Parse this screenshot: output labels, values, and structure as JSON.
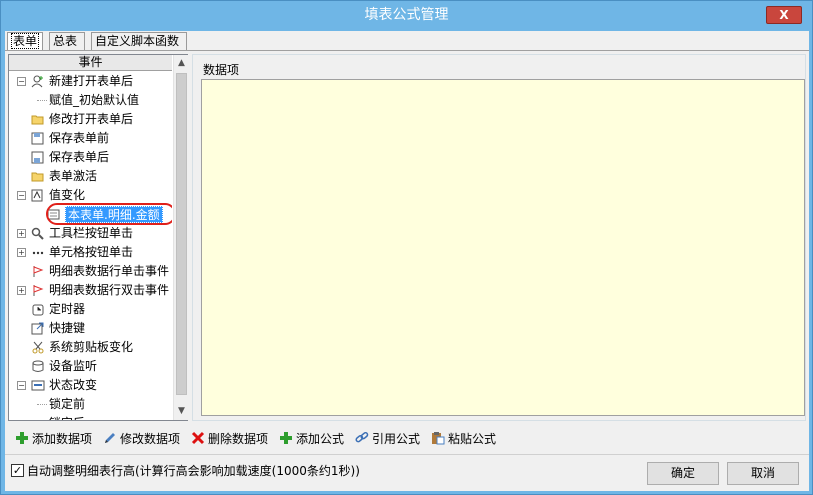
{
  "window": {
    "title": "填表公式管理",
    "close_label": "X"
  },
  "tabs": [
    {
      "label": "表单"
    },
    {
      "label": "总表"
    },
    {
      "label": "自定义脚本函数"
    }
  ],
  "tree": {
    "header": "事件",
    "items": [
      {
        "label": "新建打开表单后",
        "icon": "user-new-icon",
        "expander": "minus"
      },
      {
        "label": "赋值_初始默认值",
        "icon": "",
        "expander": ""
      },
      {
        "label": "修改打开表单后",
        "icon": "folder-open-icon",
        "expander": ""
      },
      {
        "label": "保存表单前",
        "icon": "save-icon",
        "expander": ""
      },
      {
        "label": "保存表单后",
        "icon": "save-after-icon",
        "expander": ""
      },
      {
        "label": "表单激活",
        "icon": "folder-icon",
        "expander": ""
      },
      {
        "label": "值变化",
        "icon": "value-change-icon",
        "expander": "minus"
      },
      {
        "label": "本表单.明细.金额",
        "icon": "field-icon",
        "expander": "",
        "selected": true
      },
      {
        "label": "工具栏按钮单击",
        "icon": "tool-search-icon",
        "expander": "plus"
      },
      {
        "label": "单元格按钮单击",
        "icon": "dots-icon",
        "expander": "plus"
      },
      {
        "label": "明细表数据行单击事件",
        "icon": "flag-icon",
        "expander": ""
      },
      {
        "label": "明细表数据行双击事件",
        "icon": "flag-icon",
        "expander": "plus"
      },
      {
        "label": "定时器",
        "icon": "timer-icon",
        "expander": ""
      },
      {
        "label": "快捷键",
        "icon": "shortcut-icon",
        "expander": ""
      },
      {
        "label": "系统剪贴板变化",
        "icon": "scissors-icon",
        "expander": ""
      },
      {
        "label": "设备监听",
        "icon": "device-icon",
        "expander": ""
      },
      {
        "label": "状态改变",
        "icon": "state-icon",
        "expander": "minus"
      },
      {
        "label": "锁定前",
        "icon": "",
        "expander": ""
      },
      {
        "label": "锁定后",
        "icon": "",
        "expander": ""
      }
    ]
  },
  "data_panel": {
    "label": "数据项"
  },
  "toolbar": {
    "add_item": "添加数据项",
    "edit_item": "修改数据项",
    "delete_item": "删除数据项",
    "add_formula": "添加公式",
    "ref_formula": "引用公式",
    "paste_formula": "粘贴公式"
  },
  "footer": {
    "auto_adjust_label": "自动调整明细表行高(计算行高会影响加载速度(1000条约1秒))",
    "auto_adjust_checked": true,
    "ok_label": "确定",
    "cancel_label": "取消"
  }
}
